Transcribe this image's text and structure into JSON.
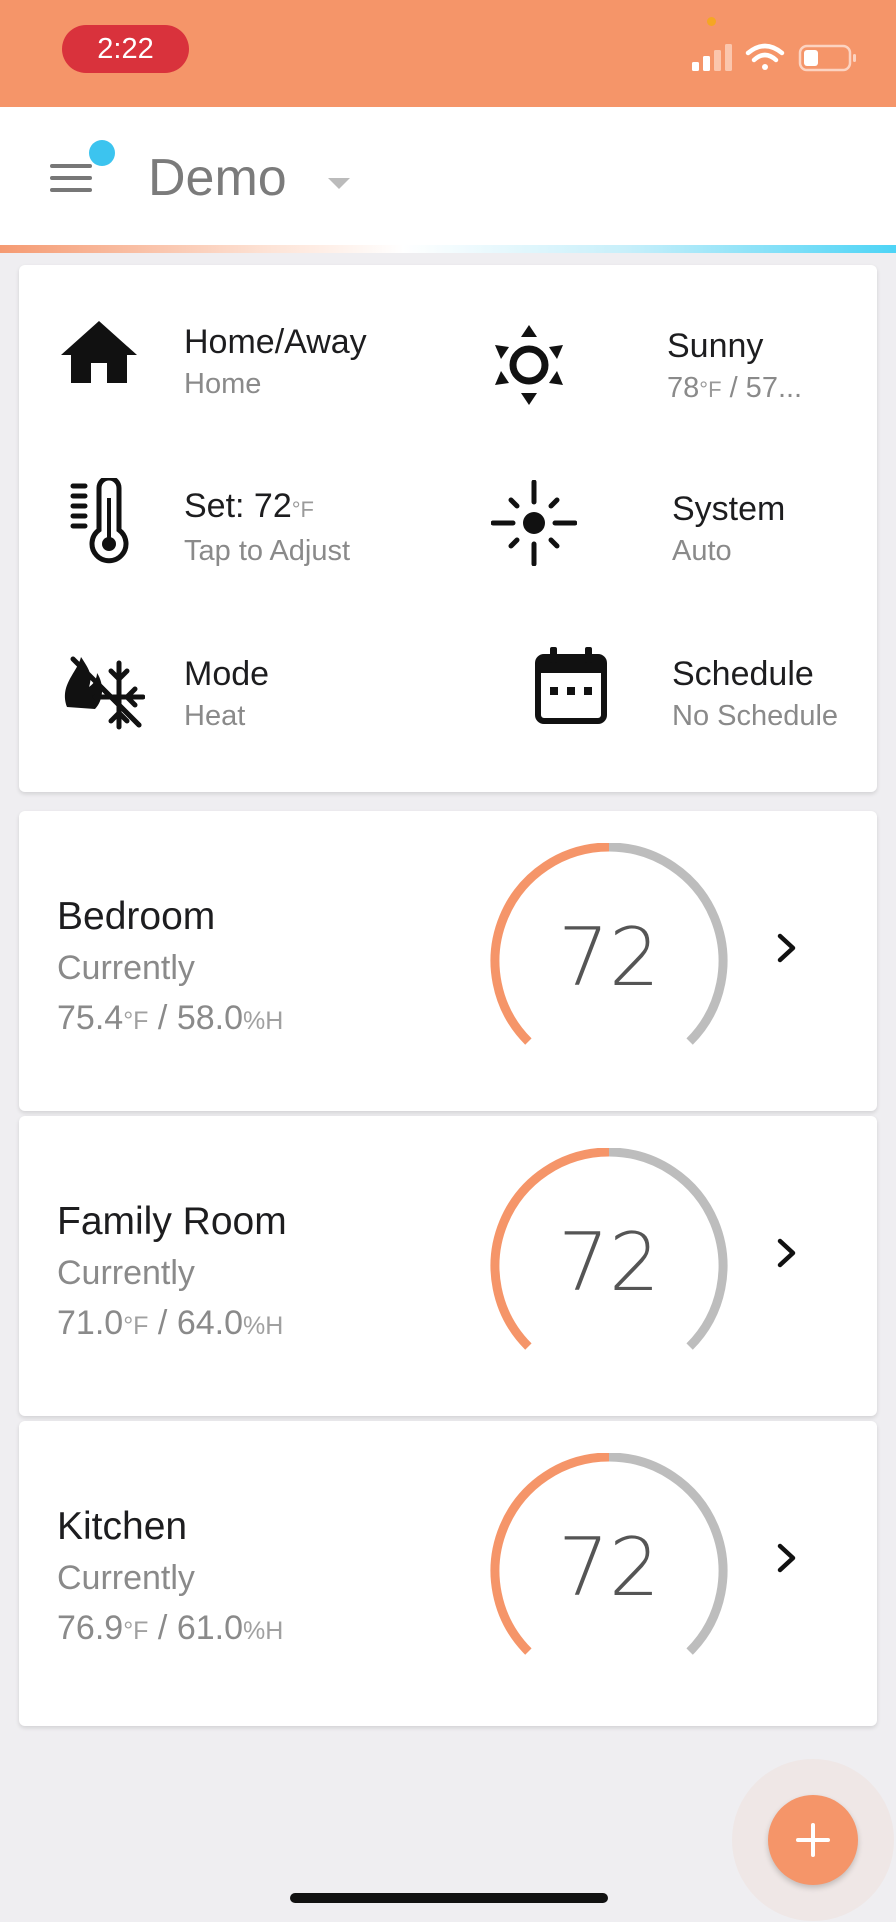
{
  "status_bar": {
    "time": "2:22"
  },
  "header": {
    "title": "Demo"
  },
  "quick_settings": [
    {
      "id": "home-away",
      "icon": "house-icon",
      "title": "Home/Away",
      "subtitle": "Home"
    },
    {
      "id": "weather",
      "icon": "sun-icon",
      "title": "Sunny",
      "subtitle_value": "78",
      "subtitle_unit": "°F",
      "subtitle_rest": " / 57..."
    },
    {
      "id": "setpoint",
      "icon": "thermometer-icon",
      "title_value": "Set: 72",
      "title_unit": "°F",
      "subtitle": "Tap to Adjust"
    },
    {
      "id": "system",
      "icon": "system-sun-icon",
      "title": "System",
      "subtitle": "Auto"
    },
    {
      "id": "mode",
      "icon": "heat-cool-icon",
      "title": "Mode",
      "subtitle": "Heat"
    },
    {
      "id": "schedule",
      "icon": "calendar-icon",
      "title": "Schedule",
      "subtitle": "No Schedule"
    }
  ],
  "zones": [
    {
      "name": "Bedroom",
      "label": "Currently",
      "temp": "75.4",
      "temp_unit": "°F",
      "sep": " / ",
      "humidity": "58.0",
      "humidity_unit": "%H",
      "setpoint": "72",
      "gauge_fraction": 0.5
    },
    {
      "name": "Family Room",
      "label": "Currently",
      "temp": "71.0",
      "temp_unit": "°F",
      "sep": " / ",
      "humidity": "64.0",
      "humidity_unit": "%H",
      "setpoint": "72",
      "gauge_fraction": 0.5
    },
    {
      "name": "Kitchen",
      "label": "Currently",
      "temp": "76.9",
      "temp_unit": "°F",
      "sep": " / ",
      "humidity": "61.0",
      "humidity_unit": "%H",
      "setpoint": "72",
      "gauge_fraction": 0.5
    }
  ],
  "colors": {
    "accent": "#f59569",
    "gauge_track": "#bdbdbd",
    "cyan": "#3cc4ef"
  },
  "fab": {
    "icon": "plus-icon"
  }
}
